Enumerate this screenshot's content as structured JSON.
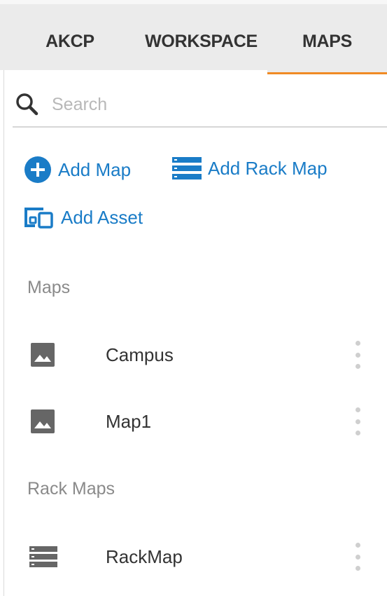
{
  "tabs": [
    {
      "label": "AKCP"
    },
    {
      "label": "WORKSPACE"
    },
    {
      "label": "MAPS",
      "active": true
    }
  ],
  "colors": {
    "accent": "#1a7cc7",
    "active_tab_underline": "#f08a24",
    "tabbar_bg": "#ebebeb"
  },
  "search": {
    "placeholder": "Search",
    "value": ""
  },
  "actions": {
    "add_map": "Add Map",
    "add_rack_map": "Add Rack Map",
    "add_asset": "Add Asset"
  },
  "sections": {
    "maps": {
      "title": "Maps",
      "items": [
        {
          "name": "Campus",
          "icon": "image-icon"
        },
        {
          "name": "Map1",
          "icon": "image-icon"
        }
      ]
    },
    "rack_maps": {
      "title": "Rack Maps",
      "items": [
        {
          "name": "RackMap",
          "icon": "rack-icon"
        }
      ]
    }
  }
}
